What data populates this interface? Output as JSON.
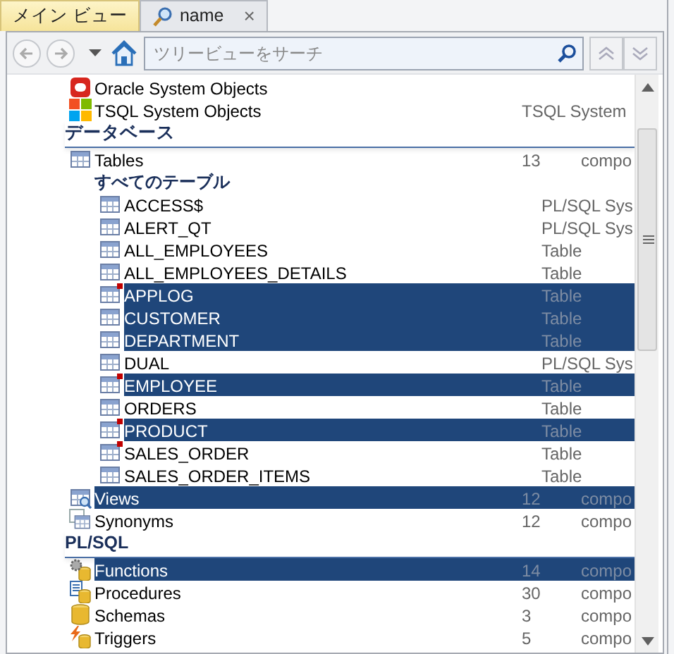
{
  "tabs": [
    {
      "label": "メイン ビュー",
      "selected": true
    },
    {
      "label": "name",
      "selected": false,
      "close": "×"
    }
  ],
  "toolbar": {
    "search": {
      "placeholder": "ツリービューをサーチ"
    }
  },
  "tree": {
    "sections": [
      {
        "items": [
          {
            "name": "Oracle System Objects",
            "kind": "oracle",
            "selected": false
          },
          {
            "name": "TSQL System Objects",
            "kind": "tsql",
            "count": "TSQL System",
            "selected": false
          }
        ]
      },
      {
        "header": "データベース",
        "items": [
          {
            "name": "Tables",
            "kind": "table",
            "count": "13",
            "type": "compo",
            "selected": false,
            "children": [
              {
                "label": "すべてのテーブル",
                "children": [
                  {
                    "name": "ACCESS$",
                    "type": "PL/SQL Sys",
                    "selected": false,
                    "marked": false
                  },
                  {
                    "name": "ALERT_QT",
                    "type": "PL/SQL Sys",
                    "selected": false,
                    "marked": false
                  },
                  {
                    "name": "ALL_EMPLOYEES",
                    "type": "Table",
                    "selected": false,
                    "marked": false
                  },
                  {
                    "name": "ALL_EMPLOYEES_DETAILS",
                    "type": "Table",
                    "selected": false,
                    "marked": false
                  },
                  {
                    "name": "APPLOG",
                    "type": "Table",
                    "selected": true,
                    "marked": true
                  },
                  {
                    "name": "CUSTOMER",
                    "type": "Table",
                    "selected": true,
                    "marked": false
                  },
                  {
                    "name": "DEPARTMENT",
                    "type": "Table",
                    "selected": true,
                    "marked": false
                  },
                  {
                    "name": "DUAL",
                    "type": "PL/SQL Sys",
                    "selected": false,
                    "marked": false
                  },
                  {
                    "name": "EMPLOYEE",
                    "type": "Table",
                    "selected": true,
                    "marked": true
                  },
                  {
                    "name": "ORDERS",
                    "type": "Table",
                    "selected": false,
                    "marked": false
                  },
                  {
                    "name": "PRODUCT",
                    "type": "Table",
                    "selected": true,
                    "marked": true
                  },
                  {
                    "name": "SALES_ORDER",
                    "type": "Table",
                    "selected": false,
                    "marked": true
                  },
                  {
                    "name": "SALES_ORDER_ITEMS",
                    "type": "Table",
                    "selected": false,
                    "marked": false
                  }
                ]
              }
            ]
          },
          {
            "name": "Views",
            "kind": "views",
            "count": "12",
            "type": "compo",
            "selected": true
          },
          {
            "name": "Synonyms",
            "kind": "synonyms",
            "count": "12",
            "type": "compo",
            "selected": false
          }
        ]
      },
      {
        "header": "PL/SQL",
        "items": [
          {
            "name": "Functions",
            "kind": "functions",
            "count": "14",
            "type": "compo",
            "selected": true
          },
          {
            "name": "Procedures",
            "kind": "procedures",
            "count": "30",
            "type": "compo",
            "selected": false
          },
          {
            "name": "Schemas",
            "kind": "schemas",
            "count": "3",
            "type": "compo",
            "selected": false
          },
          {
            "name": "Triggers",
            "kind": "triggers",
            "count": "5",
            "type": "compo",
            "selected": false
          }
        ]
      }
    ]
  }
}
